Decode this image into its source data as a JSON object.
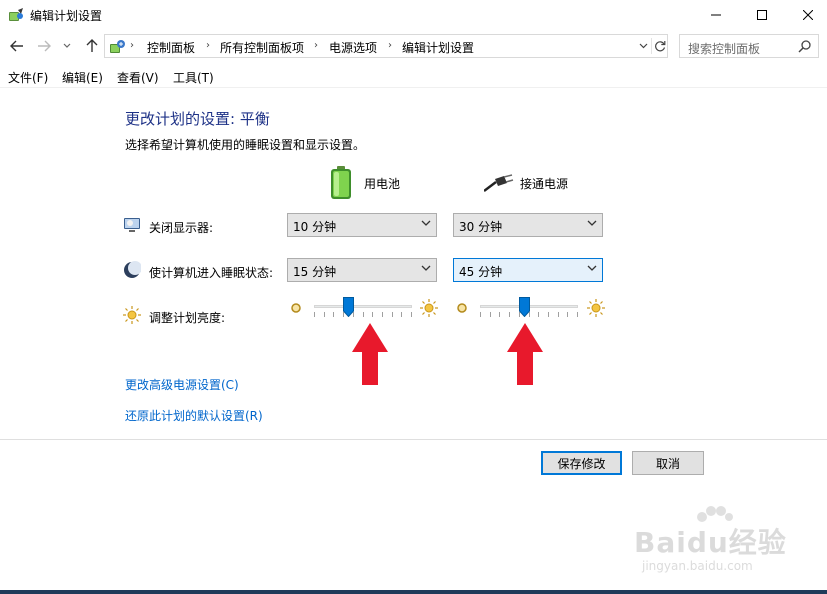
{
  "window": {
    "title": "编辑计划设置"
  },
  "nav": {
    "breadcrumbs": [
      "控制面板",
      "所有控制面板项",
      "电源选项",
      "编辑计划设置"
    ],
    "search_placeholder": "搜索控制面板"
  },
  "menu": [
    "文件(F)",
    "编辑(E)",
    "查看(V)",
    "工具(T)"
  ],
  "page": {
    "title": "更改计划的设置: 平衡",
    "subtitle": "选择希望计算机使用的睡眠设置和显示设置。"
  },
  "columns": {
    "battery": "用电池",
    "plugged_in": "接通电源"
  },
  "settings": {
    "display_off": {
      "label": "关闭显示器:",
      "battery": "10 分钟",
      "plugged_in": "30 分钟"
    },
    "sleep": {
      "label": "使计算机进入睡眠状态:",
      "battery": "15 分钟",
      "plugged_in": "45 分钟"
    },
    "brightness": {
      "label": "调整计划亮度:",
      "battery_level": 0.33,
      "plugged_in_level": 0.45
    }
  },
  "links": {
    "advanced": "更改高级电源设置(C)",
    "restore": "还原此计划的默认设置(R)"
  },
  "buttons": {
    "save": "保存修改",
    "cancel": "取消"
  },
  "watermark": {
    "main": "Baidu经验",
    "sub": "jingyan.baidu.com"
  },
  "colors": {
    "title_blue": "#1e3287",
    "link_blue": "#0066cc",
    "focus_blue": "#0078d7",
    "arrow_red": "#e8192c"
  }
}
